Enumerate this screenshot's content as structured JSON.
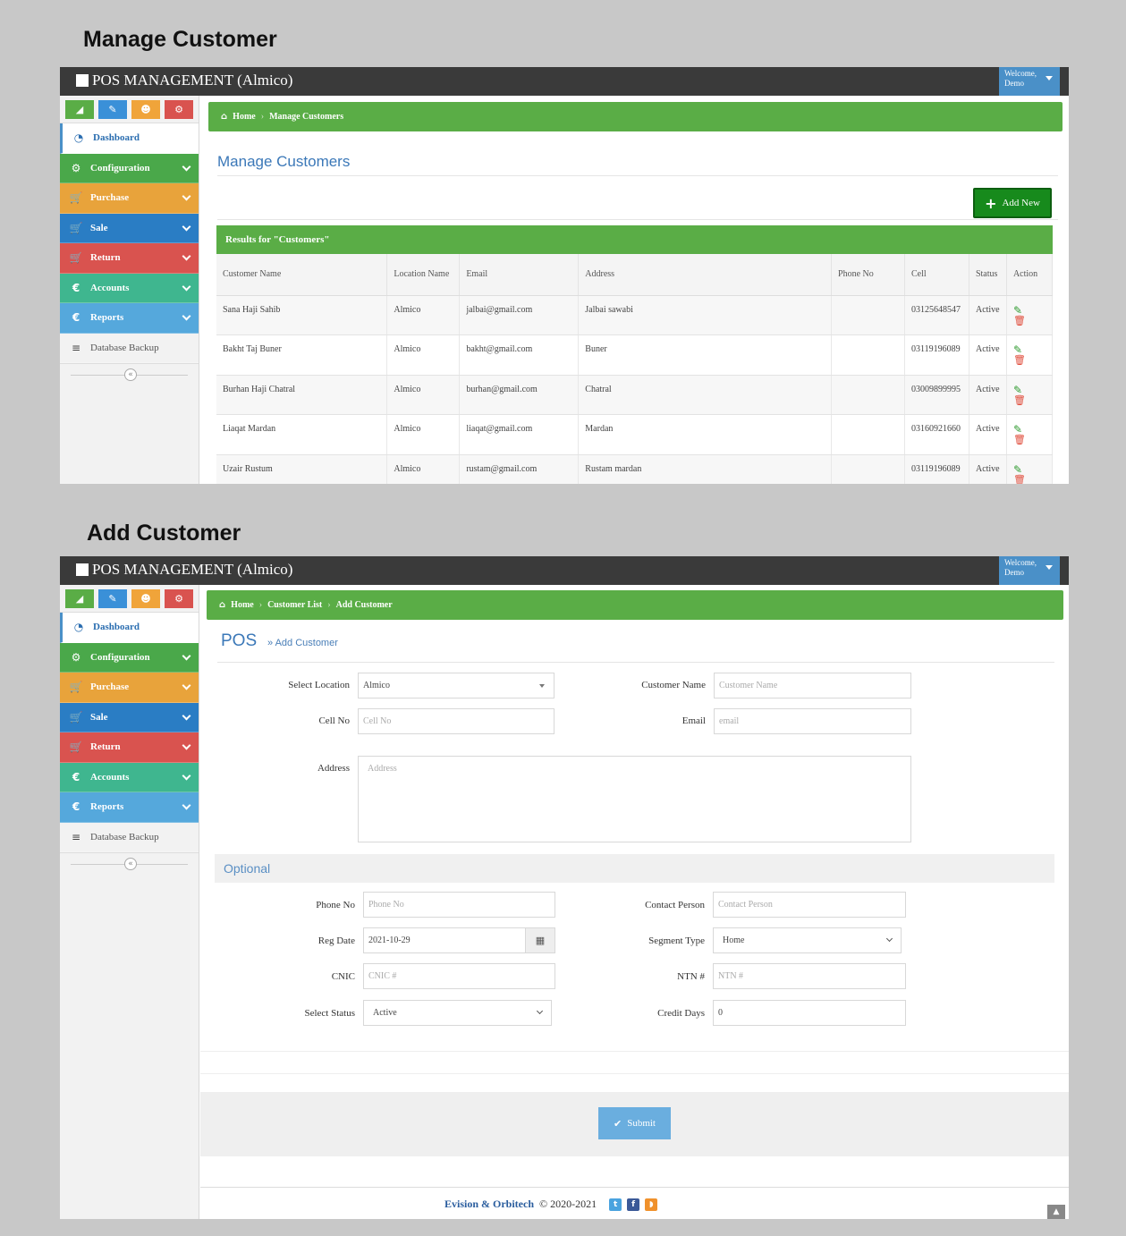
{
  "sections": {
    "manage_title": "Manage Customer",
    "add_title": "Add Customer"
  },
  "app": {
    "brand": "POS MANAGEMENT (Almico)",
    "welcome_line1": "Welcome,",
    "welcome_line2": "Demo"
  },
  "sidebar": {
    "shortcut_icons": [
      "signal-icon",
      "pencil-icon",
      "users-icon",
      "cogs-icon"
    ],
    "items": [
      {
        "label": "Dashboard",
        "icon": "dashboard-icon"
      },
      {
        "label": "Configuration",
        "icon": "cogs-icon"
      },
      {
        "label": "Purchase",
        "icon": "cart-icon"
      },
      {
        "label": "Sale",
        "icon": "cart-icon"
      },
      {
        "label": "Return",
        "icon": "cart-icon"
      },
      {
        "label": "Accounts",
        "icon": "euro-icon"
      },
      {
        "label": "Reports",
        "icon": "euro-icon"
      },
      {
        "label": "Database Backup",
        "icon": "database-icon"
      }
    ],
    "colors": {
      "configuration": "#4aa84a",
      "purchase": "#e8a33b",
      "sale": "#2a7dc4",
      "return": "#d9534f",
      "accounts": "#3fb68f",
      "reports": "#55a8dc"
    }
  },
  "manage": {
    "breadcrumb": {
      "home": "Home",
      "current": "Manage Customers"
    },
    "heading": "Manage Customers",
    "add_new": "Add New",
    "results_title": "Results for \"Customers\"",
    "columns": [
      "Customer Name",
      "Location Name",
      "Email",
      "Address",
      "Phone No",
      "Cell",
      "Status",
      "Action"
    ],
    "rows": [
      {
        "name": "Sana Haji Sahib",
        "location": "Almico",
        "email": "jalbai@gmail.com",
        "address": "Jalbai sawabi",
        "phone": "",
        "cell": "03125648547",
        "status": "Active"
      },
      {
        "name": "Bakht Taj Buner",
        "location": "Almico",
        "email": "bakht@gmail.com",
        "address": "Buner",
        "phone": "",
        "cell": "03119196089",
        "status": "Active"
      },
      {
        "name": "Burhan Haji Chatral",
        "location": "Almico",
        "email": "burhan@gmail.com",
        "address": "Chatral",
        "phone": "",
        "cell": "03009899995",
        "status": "Active"
      },
      {
        "name": "Liaqat Mardan",
        "location": "Almico",
        "email": "liaqat@gmail.com",
        "address": "Mardan",
        "phone": "",
        "cell": "03160921660",
        "status": "Active"
      },
      {
        "name": "Uzair Rustum",
        "location": "Almico",
        "email": "rustam@gmail.com",
        "address": "Rustam mardan",
        "phone": "",
        "cell": "03119196089",
        "status": "Active"
      }
    ]
  },
  "add": {
    "breadcrumb": {
      "home": "Home",
      "list": "Customer List",
      "current": "Add Customer"
    },
    "heading": "POS",
    "subheading": "» Add Customer",
    "fields": {
      "select_location": {
        "label": "Select Location",
        "value": "Almico"
      },
      "customer_name": {
        "label": "Customer Name",
        "placeholder": "Customer Name"
      },
      "cell_no": {
        "label": "Cell No",
        "placeholder": "Cell No"
      },
      "email": {
        "label": "Email",
        "placeholder": "email"
      },
      "address": {
        "label": "Address",
        "placeholder": "Address"
      }
    },
    "optional_title": "Optional",
    "optional": {
      "phone_no": {
        "label": "Phone No",
        "placeholder": "Phone No"
      },
      "contact_person": {
        "label": "Contact Person",
        "placeholder": "Contact Person"
      },
      "reg_date": {
        "label": "Reg Date",
        "value": "2021-10-29"
      },
      "segment_type": {
        "label": "Segment Type",
        "value": "Home"
      },
      "cnic": {
        "label": "CNIC",
        "placeholder": "CNIC #"
      },
      "ntn": {
        "label": "NTN #",
        "placeholder": "NTN #"
      },
      "select_status": {
        "label": "Select Status",
        "value": "Active"
      },
      "credit_days": {
        "label": "Credit Days",
        "value": "0"
      }
    },
    "submit": "Submit"
  },
  "footer": {
    "company": "Evision & Orbitech",
    "copyright": "© 2020-2021"
  }
}
